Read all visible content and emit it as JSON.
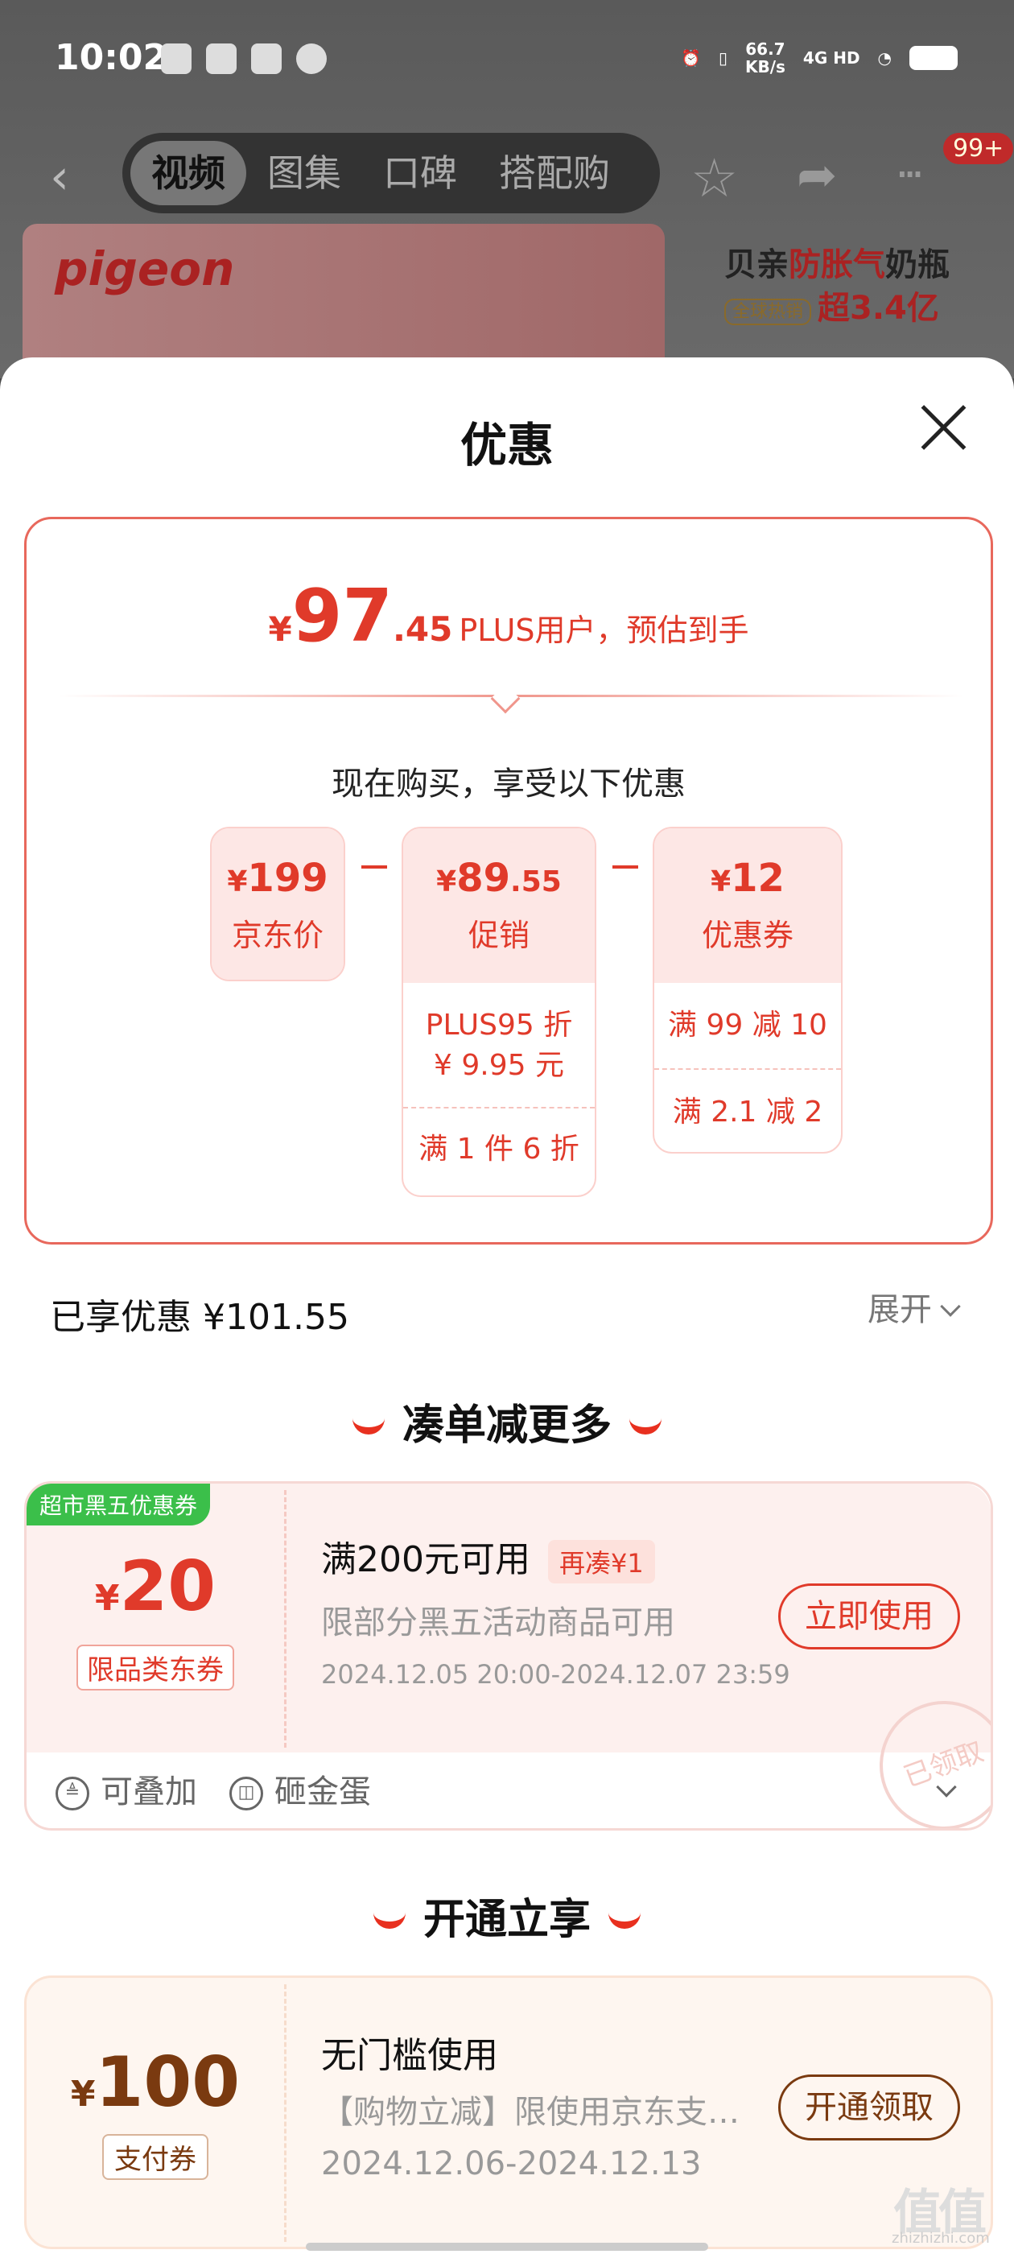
{
  "status_bar": {
    "time": "10:02",
    "speed_value": "66.7",
    "speed_unit": "KB/s",
    "network": "4G HD"
  },
  "nav": {
    "tabs": [
      "视频",
      "图集",
      "口碑",
      "搭配购"
    ],
    "badge": "99+"
  },
  "banner": {
    "brand": "pigeon",
    "promo_line1_a": "贝亲",
    "promo_line1_b": "防胀气",
    "promo_line1_c": "奶瓶",
    "promo_tag": "全球热销",
    "promo_line2": "超3.4亿"
  },
  "sheet": {
    "title": "优惠",
    "estimate": {
      "currency": "¥",
      "integer": "97",
      "decimal": ".45",
      "note": "PLUS用户，预估到手"
    },
    "buy_note": "现在购买，享受以下优惠",
    "cards": [
      {
        "currency": "¥",
        "price": "199",
        "price_small": "",
        "label": "京东价",
        "lines": []
      },
      {
        "currency": "¥",
        "price": "89",
        "price_small": ".55",
        "label": "促销",
        "lines": [
          "PLUS95 折",
          "¥ 9.95 元",
          "满 1 件 6 折"
        ]
      },
      {
        "currency": "¥",
        "price": "12",
        "price_small": "",
        "label": "优惠券",
        "lines": [
          "满 99 减 10",
          "满 2.1 减 2"
        ]
      }
    ],
    "saved": "已享优惠 ¥101.55",
    "expand": "展开"
  },
  "section1": {
    "title": "凑单减更多",
    "coupon": {
      "tag": "超市黑五优惠券",
      "currency": "¥",
      "value": "20",
      "type": "限品类东券",
      "title": "满200元可用",
      "re_tag": "再凑¥1",
      "desc": "限部分黑五活动商品可用",
      "date": "2024.12.05 20:00-2024.12.07 23:59",
      "button": "立即使用",
      "stamp": "已领取",
      "features": [
        "可叠加",
        "砸金蛋"
      ]
    }
  },
  "section2": {
    "title": "开通立享",
    "coupon": {
      "currency": "¥",
      "value": "100",
      "type": "支付券",
      "title": "无门槛使用",
      "desc": "【购物立减】限使用京东支…",
      "date": "2024.12.06-2024.12.13",
      "button": "开通领取"
    }
  },
  "watermark": {
    "main": "值值值",
    "sub": "zhizhizhi.com"
  },
  "colors": {
    "accent": "#e03a2a",
    "coupon2_text": "#7a3a10",
    "green_tag": "#3bbf4a"
  }
}
